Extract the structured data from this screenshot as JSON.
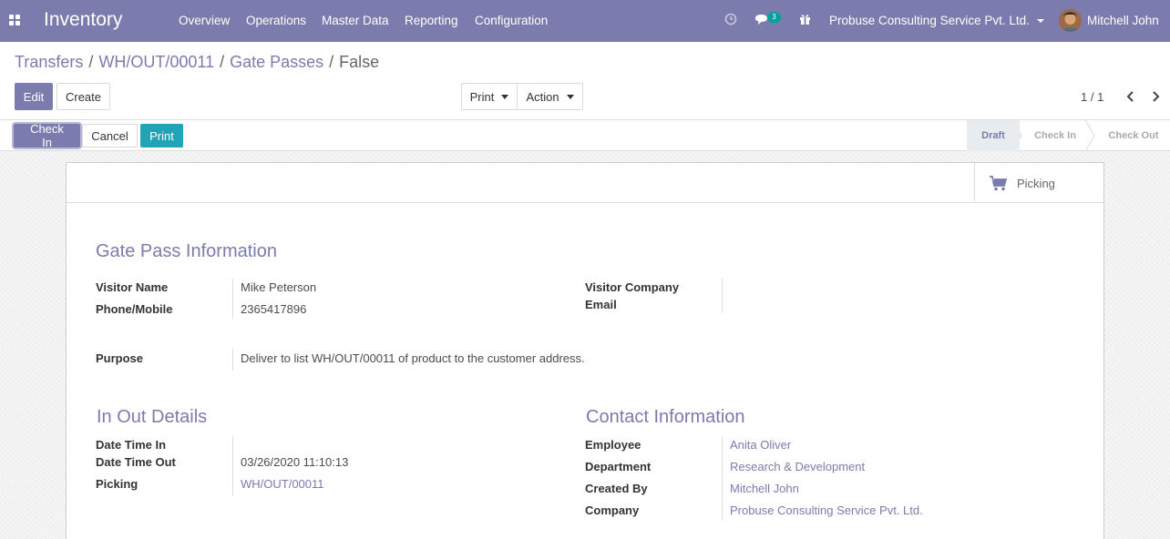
{
  "navbar": {
    "app_title": "Inventory",
    "menu": [
      "Overview",
      "Operations",
      "Master Data",
      "Reporting",
      "Configuration"
    ],
    "messages_count": "3",
    "company": "Probuse Consulting Service Pvt. Ltd.",
    "user": "Mitchell John",
    "color": "#7c7bad"
  },
  "breadcrumb": {
    "items": [
      "Transfers",
      "WH/OUT/00011",
      "Gate Passes"
    ],
    "active": "False"
  },
  "toolbar": {
    "edit": "Edit",
    "create": "Create",
    "print": "Print",
    "action": "Action",
    "pager": "1 / 1"
  },
  "statusbar": {
    "check_in": "Check In",
    "cancel": "Cancel",
    "print": "Print",
    "stages": [
      "Draft",
      "Check In",
      "Check Out"
    ],
    "current_stage": "Draft"
  },
  "smart_button": {
    "label": "Picking"
  },
  "gate_pass": {
    "heading": "Gate Pass Information",
    "visitor_name_label": "Visitor Name",
    "visitor_name": "Mike Peterson",
    "phone_label": "Phone/Mobile",
    "phone": "2365417896",
    "visitor_company_label": "Visitor Company",
    "email_label": "Email",
    "purpose_label": "Purpose",
    "purpose": "Deliver to list WH/OUT/00011 of product to the customer address."
  },
  "in_out": {
    "heading": "In Out Details",
    "date_in_label": "Date Time In",
    "date_out_label": "Date Time Out",
    "date_out": "03/26/2020 11:10:13",
    "picking_label": "Picking",
    "picking": "WH/OUT/00011"
  },
  "contact": {
    "heading": "Contact Information",
    "employee_label": "Employee",
    "employee": "Anita Oliver",
    "department_label": "Department",
    "department": "Research & Development",
    "created_by_label": "Created By",
    "created_by": "Mitchell John",
    "company_label": "Company",
    "company": "Probuse Consulting Service Pvt. Ltd."
  }
}
